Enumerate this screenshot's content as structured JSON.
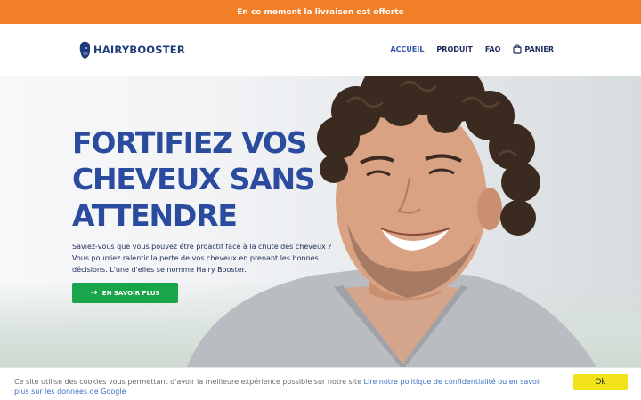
{
  "announcement": {
    "text": "En ce moment la livraison est offerte"
  },
  "brand": {
    "logo_text": "HAIRYBOOSTER"
  },
  "nav": {
    "items": [
      {
        "label": "ACCUEIL"
      },
      {
        "label": "PRODUIT"
      },
      {
        "label": "FAQ"
      },
      {
        "label": "PANIER"
      }
    ]
  },
  "hero": {
    "headline_lines": [
      "FORTIFIEZ VOS",
      "CHEVEUX SANS",
      "ATTENDRE"
    ],
    "subtitle": "Saviez-vous que vous pouvez être proactif face à la chute des cheveux ? Vous pourriez ralentir la perte de vos cheveux en prenant les bonnes décisions. L'une d'elles se nomme Hairy Booster.",
    "cta_label": "EN SAVOIR PLUS"
  },
  "cookie_banner": {
    "text": "Ce site utilise des cookies vous permettant d'avoir la meilleure expérience possible sur notre site ",
    "link_text": "Lire notre politique de confidentialité ou en savoir plus sur les données de Google",
    "button_label": "Ok"
  },
  "colors": {
    "announcement_bg": "#f27f28",
    "brand_blue": "#2b4c9e",
    "cta_green": "#19a54a",
    "cookie_button": "#f2e21a"
  }
}
